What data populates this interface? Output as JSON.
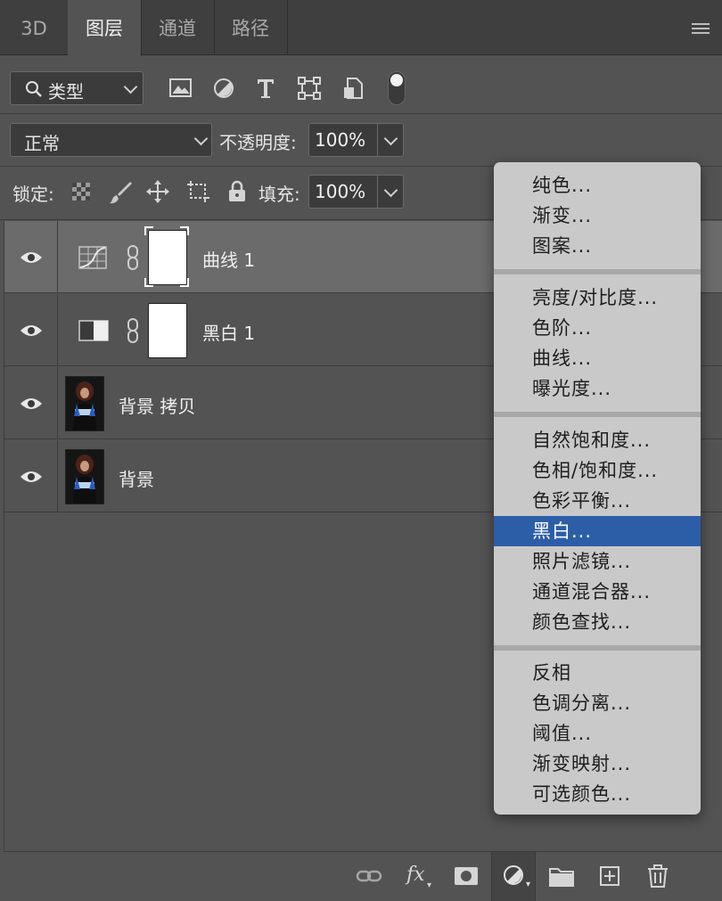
{
  "tabs": [
    {
      "label": "3D"
    },
    {
      "label": "图层"
    },
    {
      "label": "通道"
    },
    {
      "label": "路径"
    }
  ],
  "filter": {
    "kind_label": "类型"
  },
  "blend": {
    "mode": "正常",
    "opacity_label": "不透明度:",
    "opacity_value": "100%"
  },
  "lock": {
    "label": "锁定:",
    "fill_label": "填充:",
    "fill_value": "100%"
  },
  "layers": [
    {
      "name": "曲线 1",
      "selected": true
    },
    {
      "name": "黑白 1",
      "selected": false
    },
    {
      "name": "背景 拷贝",
      "selected": false
    },
    {
      "name": "背景",
      "selected": false
    }
  ],
  "popup_menu": {
    "groups": [
      [
        "纯色...",
        "渐变...",
        "图案..."
      ],
      [
        "亮度/对比度...",
        "色阶...",
        "曲线...",
        "曝光度..."
      ],
      [
        "自然饱和度...",
        "色相/饱和度...",
        "色彩平衡...",
        "黑白...",
        "照片滤镜...",
        "通道混合器...",
        "颜色查找..."
      ],
      [
        "反相",
        "色调分离...",
        "阈值...",
        "渐变映射...",
        "可选颜色..."
      ]
    ],
    "highlighted": "黑白..."
  },
  "bottom_icons": [
    "link-icon",
    "fx-icon",
    "mask-icon",
    "adjustment-icon",
    "folder-icon",
    "new-layer-icon",
    "trash-icon"
  ],
  "colors": {
    "panel": "#535353",
    "tabbar": "#3f3f3f",
    "menu_bg": "#c9c9c9",
    "highlight": "#2c5ea8"
  }
}
